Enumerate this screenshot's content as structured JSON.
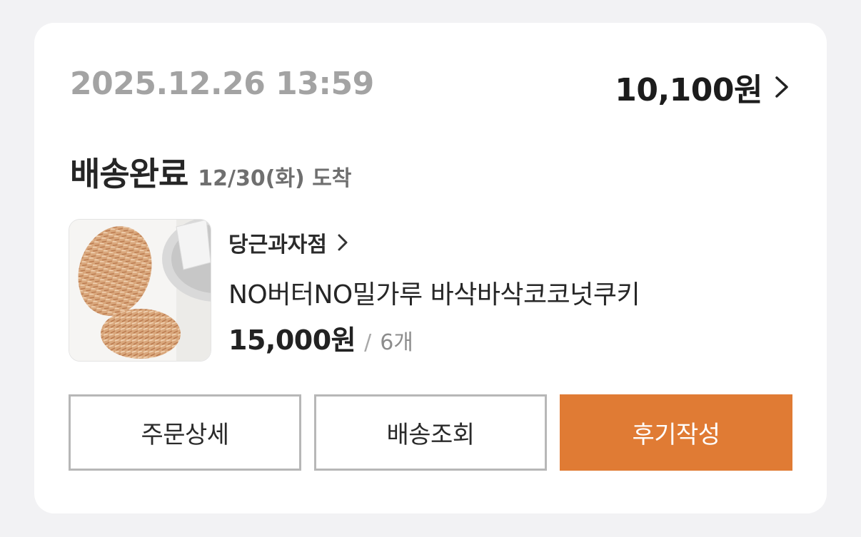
{
  "order": {
    "datetime": "2025.12.26 13:59",
    "total": "10,100원",
    "status": "배송완료",
    "arrival": "12/30(화) 도착"
  },
  "item": {
    "shop_name": "당근과자점",
    "product_name": "NO버터NO밀가루 바삭바삭코코넛쿠키",
    "price": "15,000원",
    "separator": "/",
    "quantity": "6개",
    "thumbnail_icon": "cookie-photo"
  },
  "buttons": {
    "order_detail": "주문상세",
    "track_delivery": "배송조회",
    "write_review": "후기작성"
  },
  "colors": {
    "accent": "#e07b34",
    "muted_text": "#a3a3a3",
    "card_bg": "#ffffff",
    "page_bg": "#f2f2f4"
  }
}
